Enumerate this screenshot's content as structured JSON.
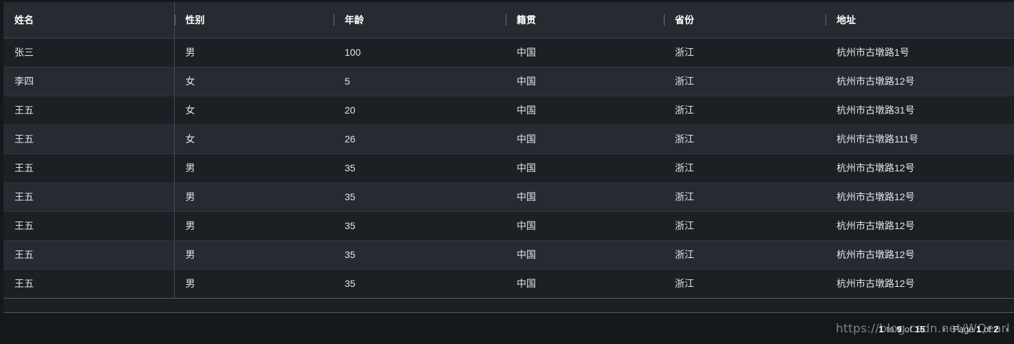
{
  "table": {
    "columns": [
      {
        "key": "name",
        "label": "姓名"
      },
      {
        "key": "gender",
        "label": "性别"
      },
      {
        "key": "age",
        "label": "年龄"
      },
      {
        "key": "origin",
        "label": "籍贯"
      },
      {
        "key": "prov",
        "label": "省份"
      },
      {
        "key": "addr",
        "label": "地址"
      }
    ],
    "rows": [
      {
        "name": "张三",
        "gender": "男",
        "age": "100",
        "origin": "中国",
        "prov": "浙江",
        "addr": "杭州市古墩路1号"
      },
      {
        "name": "李四",
        "gender": "女",
        "age": "5",
        "origin": "中国",
        "prov": "浙江",
        "addr": "杭州市古墩路12号"
      },
      {
        "name": "王五",
        "gender": "女",
        "age": "20",
        "origin": "中国",
        "prov": "浙江",
        "addr": "杭州市古墩路31号"
      },
      {
        "name": "王五",
        "gender": "女",
        "age": "26",
        "origin": "中国",
        "prov": "浙江",
        "addr": "杭州市古墩路111号"
      },
      {
        "name": "王五",
        "gender": "男",
        "age": "35",
        "origin": "中国",
        "prov": "浙江",
        "addr": "杭州市古墩路12号"
      },
      {
        "name": "王五",
        "gender": "男",
        "age": "35",
        "origin": "中国",
        "prov": "浙江",
        "addr": "杭州市古墩路12号"
      },
      {
        "name": "王五",
        "gender": "男",
        "age": "35",
        "origin": "中国",
        "prov": "浙江",
        "addr": "杭州市古墩路12号"
      },
      {
        "name": "王五",
        "gender": "男",
        "age": "35",
        "origin": "中国",
        "prov": "浙江",
        "addr": "杭州市古墩路12号"
      },
      {
        "name": "王五",
        "gender": "男",
        "age": "35",
        "origin": "中国",
        "prov": "浙江",
        "addr": "杭州市古墩路12号"
      }
    ]
  },
  "footer": {
    "range": {
      "from": "1",
      "to_word": " to ",
      "to": "9",
      "of_word": " of ",
      "total": "15"
    },
    "pager": {
      "prev_icon": "‹",
      "page_word": "Page ",
      "page_current": "1",
      "page_of_word": " of ",
      "page_total": "2",
      "next_icon": "›"
    },
    "watermark": "https://blog.csdn.net/WQearl"
  },
  "colors": {
    "page_bg": "#14181b",
    "header_bg": "#252b31",
    "row_odd": "#1b2024",
    "row_even": "#252b31",
    "text": "#e4e7ea",
    "divider": "#454d55"
  }
}
